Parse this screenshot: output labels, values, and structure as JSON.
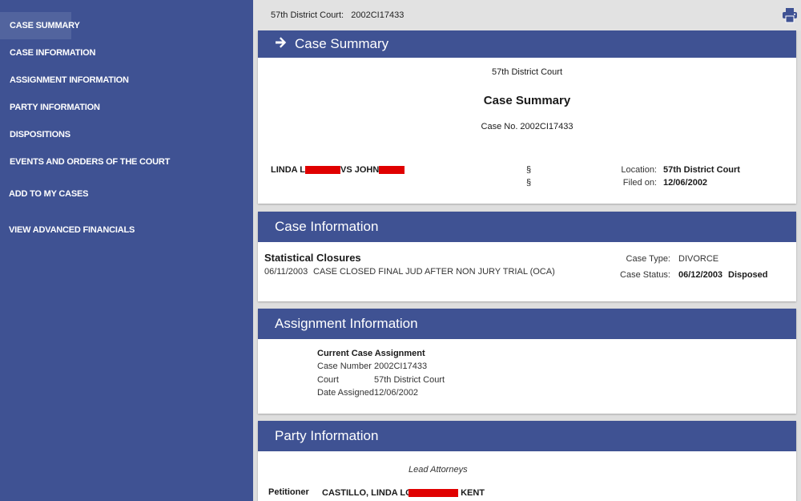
{
  "sidebar": {
    "items": [
      {
        "label": "CASE SUMMARY"
      },
      {
        "label": "CASE INFORMATION"
      },
      {
        "label": "ASSIGNMENT INFORMATION"
      },
      {
        "label": "PARTY INFORMATION"
      },
      {
        "label": "DISPOSITIONS"
      },
      {
        "label": "EVENTS AND ORDERS OF THE COURT"
      },
      {
        "label": "ADD TO MY CASES"
      },
      {
        "label": "VIEW ADVANCED FINANCIALS"
      }
    ]
  },
  "topbar": {
    "court_label": "57th District Court:",
    "case_number": "2002CI17433"
  },
  "case_summary": {
    "header": "Case Summary",
    "court": "57th District Court",
    "title": "Case Summary",
    "case_no": "Case No. 2002CI17433",
    "party_left_first": "LINDA L",
    "party_vs": "VS JOHN",
    "section_symbol_1": "§",
    "section_symbol_2": "§",
    "location_label": "Location:",
    "location_value": "57th District Court",
    "filed_label": "Filed on:",
    "filed_value": "12/06/2002"
  },
  "case_information": {
    "header": "Case Information",
    "statistical_closures_title": "Statistical Closures",
    "closure_date": "06/11/2003",
    "closure_text": "CASE CLOSED FINAL JUD AFTER NON JURY TRIAL (OCA)",
    "case_type_label": "Case Type:",
    "case_type_value": "DIVORCE",
    "case_status_label": "Case Status:",
    "case_status_date": "06/12/2003",
    "case_status_value": "Disposed"
  },
  "assignment_information": {
    "header": "Assignment Information",
    "current_title": "Current Case Assignment",
    "rows": [
      {
        "label": "Case Number",
        "value": "2002CI17433"
      },
      {
        "label": "Court",
        "value": "57th District Court"
      },
      {
        "label": "Date Assigned",
        "value": "12/06/2002"
      }
    ]
  },
  "party_information": {
    "header": "Party Information",
    "lead_attorneys": "Lead Attorneys",
    "role": "Petitioner",
    "name": "CASTILLO, LINDA LOU",
    "attorney_suffix": "KENT"
  },
  "colors": {
    "sidebar": "#3f5293",
    "header": "#3f5293",
    "redaction": "#e00000"
  }
}
